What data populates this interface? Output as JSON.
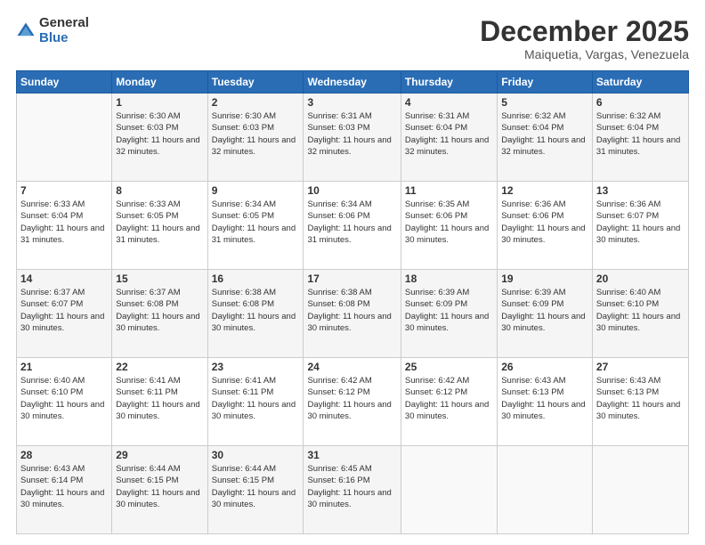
{
  "logo": {
    "general": "General",
    "blue": "Blue"
  },
  "header": {
    "month": "December 2025",
    "location": "Maiquetia, Vargas, Venezuela"
  },
  "days_header": [
    "Sunday",
    "Monday",
    "Tuesday",
    "Wednesday",
    "Thursday",
    "Friday",
    "Saturday"
  ],
  "weeks": [
    [
      {
        "num": "",
        "sunrise": "",
        "sunset": "",
        "daylight": ""
      },
      {
        "num": "1",
        "sunrise": "Sunrise: 6:30 AM",
        "sunset": "Sunset: 6:03 PM",
        "daylight": "Daylight: 11 hours and 32 minutes."
      },
      {
        "num": "2",
        "sunrise": "Sunrise: 6:30 AM",
        "sunset": "Sunset: 6:03 PM",
        "daylight": "Daylight: 11 hours and 32 minutes."
      },
      {
        "num": "3",
        "sunrise": "Sunrise: 6:31 AM",
        "sunset": "Sunset: 6:03 PM",
        "daylight": "Daylight: 11 hours and 32 minutes."
      },
      {
        "num": "4",
        "sunrise": "Sunrise: 6:31 AM",
        "sunset": "Sunset: 6:04 PM",
        "daylight": "Daylight: 11 hours and 32 minutes."
      },
      {
        "num": "5",
        "sunrise": "Sunrise: 6:32 AM",
        "sunset": "Sunset: 6:04 PM",
        "daylight": "Daylight: 11 hours and 32 minutes."
      },
      {
        "num": "6",
        "sunrise": "Sunrise: 6:32 AM",
        "sunset": "Sunset: 6:04 PM",
        "daylight": "Daylight: 11 hours and 31 minutes."
      }
    ],
    [
      {
        "num": "7",
        "sunrise": "Sunrise: 6:33 AM",
        "sunset": "Sunset: 6:04 PM",
        "daylight": "Daylight: 11 hours and 31 minutes."
      },
      {
        "num": "8",
        "sunrise": "Sunrise: 6:33 AM",
        "sunset": "Sunset: 6:05 PM",
        "daylight": "Daylight: 11 hours and 31 minutes."
      },
      {
        "num": "9",
        "sunrise": "Sunrise: 6:34 AM",
        "sunset": "Sunset: 6:05 PM",
        "daylight": "Daylight: 11 hours and 31 minutes."
      },
      {
        "num": "10",
        "sunrise": "Sunrise: 6:34 AM",
        "sunset": "Sunset: 6:06 PM",
        "daylight": "Daylight: 11 hours and 31 minutes."
      },
      {
        "num": "11",
        "sunrise": "Sunrise: 6:35 AM",
        "sunset": "Sunset: 6:06 PM",
        "daylight": "Daylight: 11 hours and 30 minutes."
      },
      {
        "num": "12",
        "sunrise": "Sunrise: 6:36 AM",
        "sunset": "Sunset: 6:06 PM",
        "daylight": "Daylight: 11 hours and 30 minutes."
      },
      {
        "num": "13",
        "sunrise": "Sunrise: 6:36 AM",
        "sunset": "Sunset: 6:07 PM",
        "daylight": "Daylight: 11 hours and 30 minutes."
      }
    ],
    [
      {
        "num": "14",
        "sunrise": "Sunrise: 6:37 AM",
        "sunset": "Sunset: 6:07 PM",
        "daylight": "Daylight: 11 hours and 30 minutes."
      },
      {
        "num": "15",
        "sunrise": "Sunrise: 6:37 AM",
        "sunset": "Sunset: 6:08 PM",
        "daylight": "Daylight: 11 hours and 30 minutes."
      },
      {
        "num": "16",
        "sunrise": "Sunrise: 6:38 AM",
        "sunset": "Sunset: 6:08 PM",
        "daylight": "Daylight: 11 hours and 30 minutes."
      },
      {
        "num": "17",
        "sunrise": "Sunrise: 6:38 AM",
        "sunset": "Sunset: 6:08 PM",
        "daylight": "Daylight: 11 hours and 30 minutes."
      },
      {
        "num": "18",
        "sunrise": "Sunrise: 6:39 AM",
        "sunset": "Sunset: 6:09 PM",
        "daylight": "Daylight: 11 hours and 30 minutes."
      },
      {
        "num": "19",
        "sunrise": "Sunrise: 6:39 AM",
        "sunset": "Sunset: 6:09 PM",
        "daylight": "Daylight: 11 hours and 30 minutes."
      },
      {
        "num": "20",
        "sunrise": "Sunrise: 6:40 AM",
        "sunset": "Sunset: 6:10 PM",
        "daylight": "Daylight: 11 hours and 30 minutes."
      }
    ],
    [
      {
        "num": "21",
        "sunrise": "Sunrise: 6:40 AM",
        "sunset": "Sunset: 6:10 PM",
        "daylight": "Daylight: 11 hours and 30 minutes."
      },
      {
        "num": "22",
        "sunrise": "Sunrise: 6:41 AM",
        "sunset": "Sunset: 6:11 PM",
        "daylight": "Daylight: 11 hours and 30 minutes."
      },
      {
        "num": "23",
        "sunrise": "Sunrise: 6:41 AM",
        "sunset": "Sunset: 6:11 PM",
        "daylight": "Daylight: 11 hours and 30 minutes."
      },
      {
        "num": "24",
        "sunrise": "Sunrise: 6:42 AM",
        "sunset": "Sunset: 6:12 PM",
        "daylight": "Daylight: 11 hours and 30 minutes."
      },
      {
        "num": "25",
        "sunrise": "Sunrise: 6:42 AM",
        "sunset": "Sunset: 6:12 PM",
        "daylight": "Daylight: 11 hours and 30 minutes."
      },
      {
        "num": "26",
        "sunrise": "Sunrise: 6:43 AM",
        "sunset": "Sunset: 6:13 PM",
        "daylight": "Daylight: 11 hours and 30 minutes."
      },
      {
        "num": "27",
        "sunrise": "Sunrise: 6:43 AM",
        "sunset": "Sunset: 6:13 PM",
        "daylight": "Daylight: 11 hours and 30 minutes."
      }
    ],
    [
      {
        "num": "28",
        "sunrise": "Sunrise: 6:43 AM",
        "sunset": "Sunset: 6:14 PM",
        "daylight": "Daylight: 11 hours and 30 minutes."
      },
      {
        "num": "29",
        "sunrise": "Sunrise: 6:44 AM",
        "sunset": "Sunset: 6:15 PM",
        "daylight": "Daylight: 11 hours and 30 minutes."
      },
      {
        "num": "30",
        "sunrise": "Sunrise: 6:44 AM",
        "sunset": "Sunset: 6:15 PM",
        "daylight": "Daylight: 11 hours and 30 minutes."
      },
      {
        "num": "31",
        "sunrise": "Sunrise: 6:45 AM",
        "sunset": "Sunset: 6:16 PM",
        "daylight": "Daylight: 11 hours and 30 minutes."
      },
      {
        "num": "",
        "sunrise": "",
        "sunset": "",
        "daylight": ""
      },
      {
        "num": "",
        "sunrise": "",
        "sunset": "",
        "daylight": ""
      },
      {
        "num": "",
        "sunrise": "",
        "sunset": "",
        "daylight": ""
      }
    ]
  ]
}
